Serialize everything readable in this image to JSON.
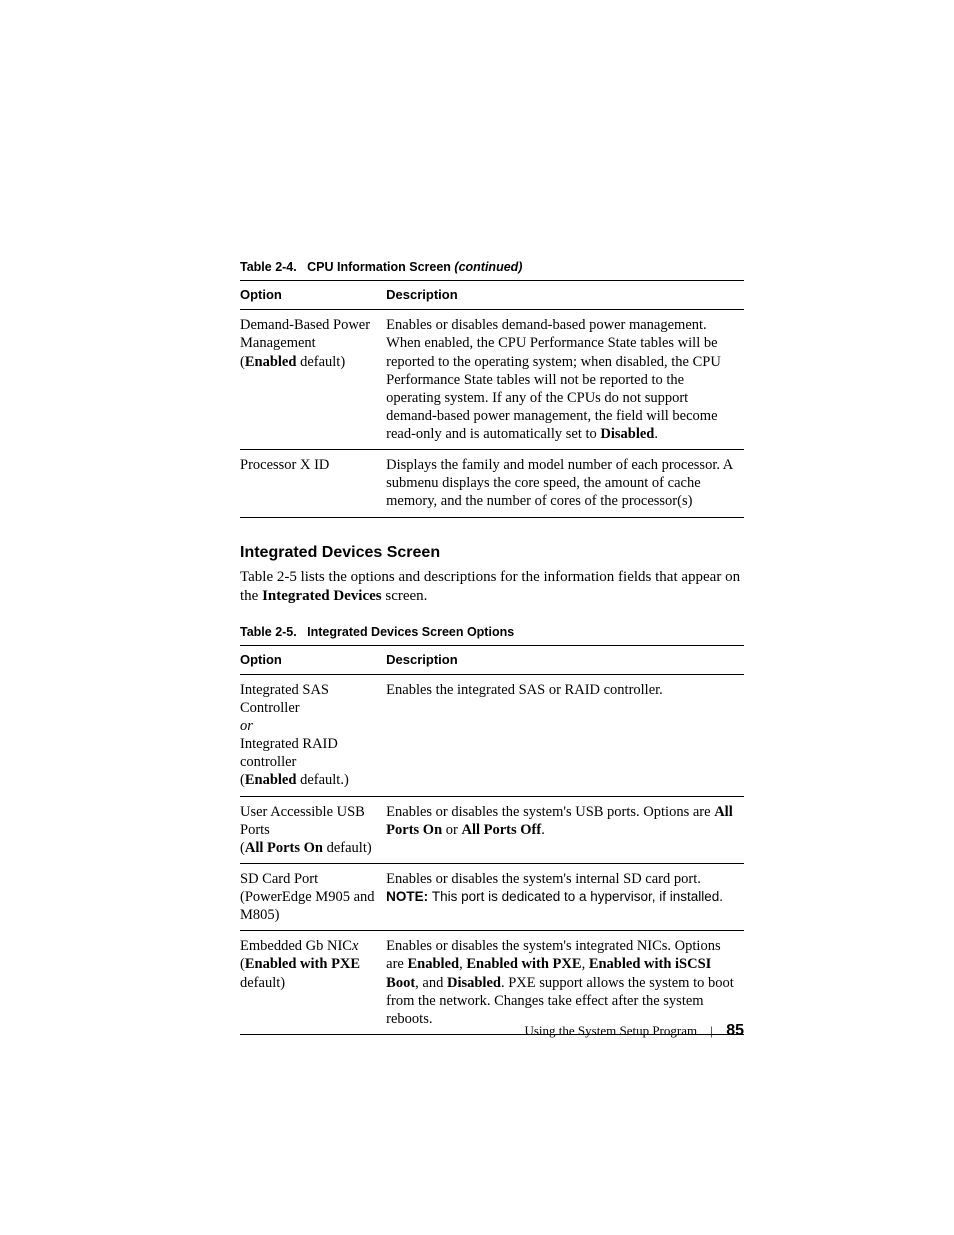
{
  "table1": {
    "caption_prefix": "Table 2-4.",
    "caption_title": "CPU Information Screen ",
    "caption_suffix": "(continued)",
    "head_option": "Option",
    "head_desc": "Description",
    "rows": [
      {
        "opt_l1": "Demand-Based Power Management",
        "opt_l2a": "(",
        "opt_l2b": "Enabled",
        "opt_l2c": " default)",
        "desc_a": "Enables or disables demand-based power management. When enabled, the CPU Performance State tables will be reported to the operating system; when disabled, the CPU Performance State tables will not be reported to the operating system. If any of the CPUs do not support demand-based power management, the field will become read-only and is automatically set to ",
        "desc_b": "Disabled",
        "desc_c": "."
      },
      {
        "opt": "Processor X ID",
        "desc": "Displays the family and model number of each processor. A submenu displays the core speed, the amount of cache memory, and the number of cores of the processor(s)"
      }
    ]
  },
  "section_heading": "Integrated Devices Screen",
  "section_para_a": "Table 2-5 lists the options and descriptions for the information fields that appear on the ",
  "section_para_b": "Integrated Devices",
  "section_para_c": " screen.",
  "table2": {
    "caption_prefix": "Table 2-5.",
    "caption_title": "Integrated Devices Screen Options",
    "head_option": "Option",
    "head_desc": "Description",
    "rows": [
      {
        "opt_l1": "Integrated SAS Controller",
        "opt_or": "or",
        "opt_l2": "Integrated RAID controller",
        "opt_def_a": "(",
        "opt_def_b": "Enabled",
        "opt_def_c": " default.)",
        "desc": "Enables the integrated SAS or RAID controller."
      },
      {
        "opt_l1": "User Accessible USB Ports",
        "opt_def_a": "(",
        "opt_def_b": "All Ports On",
        "opt_def_c": " default)",
        "desc_a": "Enables or disables the system's USB ports. Options are ",
        "desc_b": "All Ports On",
        "desc_c": " or ",
        "desc_d": "All Ports Off",
        "desc_e": "."
      },
      {
        "opt_l1": "SD Card Port",
        "opt_l2": "(PowerEdge M905 and M805)",
        "desc_a": "Enables or disables the system's internal SD card port.",
        "note_label": "NOTE: ",
        "note_text": "This port is dedicated to a hypervisor, if installed."
      },
      {
        "opt_l1a": "Embedded Gb NIC",
        "opt_l1b": "x",
        "opt_def_a": "(",
        "opt_def_b": "Enabled with PXE",
        "opt_def_c": " default)",
        "desc_a": "Enables or disables the system's integrated NICs. Options are ",
        "desc_b": "Enabled",
        "desc_c": ", ",
        "desc_d": "Enabled with PXE",
        "desc_e": ", ",
        "desc_f": "Enabled with iSCSI Boot",
        "desc_g": ", and ",
        "desc_h": "Disabled",
        "desc_i": ". PXE support allows the system to boot from the network. Changes take effect after the system reboots."
      }
    ]
  },
  "footer": {
    "text": "Using the System Setup Program",
    "sep": "|",
    "page": "85"
  }
}
